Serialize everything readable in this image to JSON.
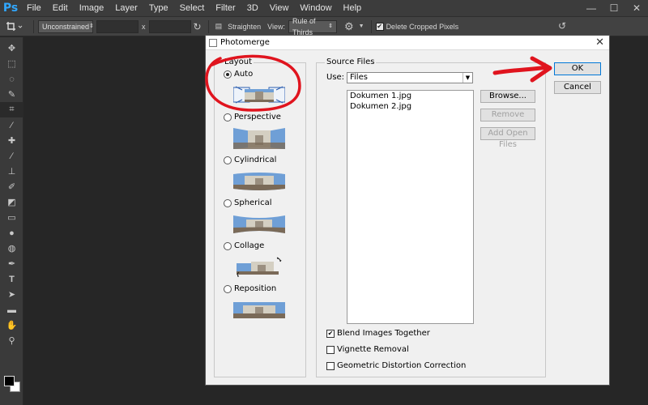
{
  "app": {
    "logo": "Ps",
    "menu": [
      "File",
      "Edit",
      "Image",
      "Layer",
      "Type",
      "Select",
      "Filter",
      "3D",
      "View",
      "Window",
      "Help"
    ],
    "window_controls": [
      "—",
      "☐",
      "✕"
    ]
  },
  "options_bar": {
    "ratio_select": "Unconstrained",
    "swap_symbol": "x",
    "straighten_label": "Straighten",
    "view_label": "View:",
    "view_select": "Rule of Thirds",
    "delete_cropped_label": "Delete Cropped Pixels",
    "delete_cropped_checked": true
  },
  "dialog": {
    "title": "Photomerge",
    "layout": {
      "label": "Layout",
      "options": [
        {
          "label": "Auto",
          "selected": true
        },
        {
          "label": "Perspective",
          "selected": false
        },
        {
          "label": "Cylindrical",
          "selected": false
        },
        {
          "label": "Spherical",
          "selected": false
        },
        {
          "label": "Collage",
          "selected": false
        },
        {
          "label": "Reposition",
          "selected": false
        }
      ]
    },
    "source": {
      "label": "Source Files",
      "use_label": "Use:",
      "use_value": "Files",
      "files": [
        "Dokumen 1.jpg",
        "Dokumen 2.jpg"
      ],
      "browse_label": "Browse...",
      "remove_label": "Remove",
      "add_open_label": "Add Open Files"
    },
    "options": {
      "blend_label": "Blend Images Together",
      "blend_checked": true,
      "vignette_label": "Vignette Removal",
      "vignette_checked": false,
      "geometric_label": "Geometric Distortion Correction",
      "geometric_checked": false
    },
    "ok_label": "OK",
    "cancel_label": "Cancel"
  },
  "colors": {
    "annotation": "#e0141e",
    "sky": "#6f9fd6",
    "building": "#d4cfc2",
    "ground": "#7a6a58"
  }
}
